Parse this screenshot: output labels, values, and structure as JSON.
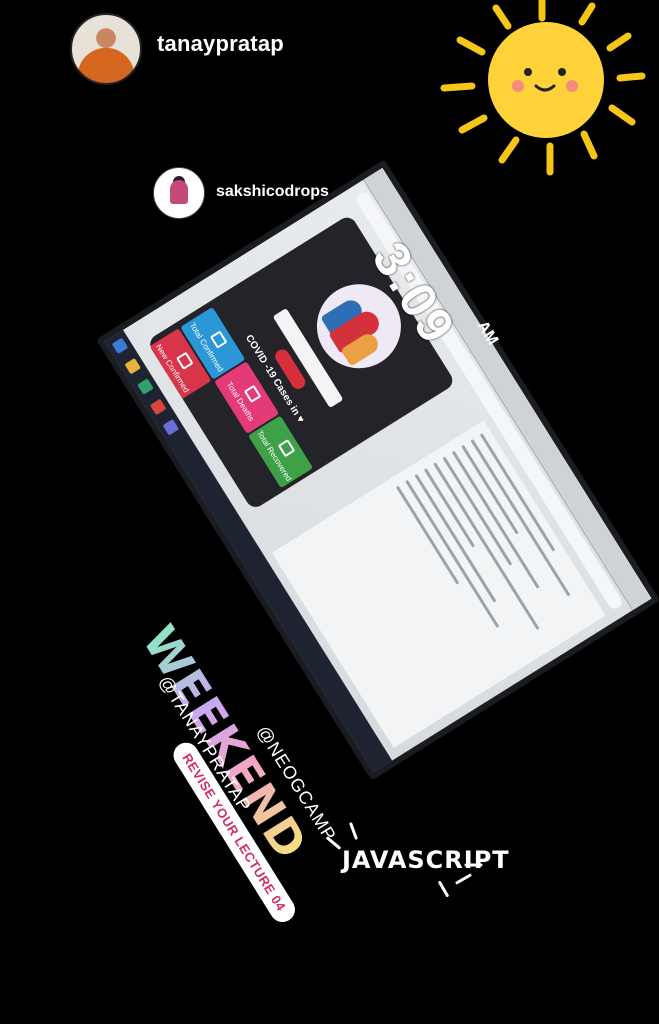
{
  "story": {
    "author": "tanaypratap",
    "reshared_from": "sakshicodrops"
  },
  "stickers": {
    "clock_time": "3:09",
    "clock_ampm": "AM",
    "weekend": "WEEKEND",
    "mention_1": "@TANAYPRATAP",
    "mention_2": "@NEOGCAMP",
    "revise": "REVISE YOUR LECTURE 04",
    "hashtag": "JAVASCRIPT"
  },
  "app": {
    "title": "COVID -19 Cases in ♥",
    "tiles": [
      "Total Confirmed",
      "Total Deaths",
      "New Confirmed",
      "Total Recovered"
    ]
  },
  "colors": {
    "background": "#000000",
    "weekend_gradient": [
      "#8ee6c3",
      "#c8a8f0",
      "#f0a4c9",
      "#f5e07c"
    ],
    "revise_text": "#d22c6c"
  }
}
